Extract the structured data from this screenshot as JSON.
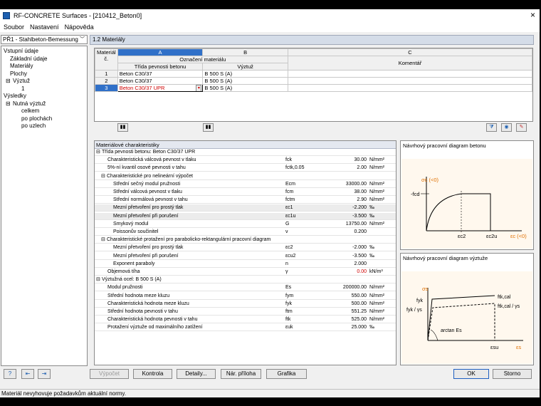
{
  "window": {
    "title": "RF-CONCRETE Surfaces - [210412_Beton0]",
    "close": "×"
  },
  "menu": [
    "Soubor",
    "Nastavení",
    "Nápověda"
  ],
  "case_combo": "PŘ1 - Stahlbeton-Bemessung",
  "tree": {
    "input": "Vstupní údaje",
    "basic": "Základní údaje",
    "materials": "Materiály",
    "surfaces": "Plochy",
    "reinf": "Výztuž",
    "reinf1": "1",
    "results": "Výsledky",
    "req": "Nutná výztuž",
    "total": "celkem",
    "surf": "po plochách",
    "nodes": "po uzlech"
  },
  "panel_title": "1.2 Materiály",
  "grid": {
    "col_material": "Materiál",
    "col_no": "č.",
    "col_a": "A",
    "col_b": "B",
    "col_c": "C",
    "hdr_designation": "Označení materiálu",
    "hdr_concrete": "Třída pevnosti betonu",
    "hdr_reinf": "Výztuž",
    "hdr_comment": "Komentář",
    "rows": [
      {
        "no": "1",
        "concrete": "Beton C30/37",
        "reinf": "B 500 S (A)"
      },
      {
        "no": "2",
        "concrete": "Beton C30/37",
        "reinf": "B 500 S (A)"
      },
      {
        "no": "3",
        "concrete": "Beton C30/37 UPR",
        "reinf": "B 500 S (A)"
      }
    ]
  },
  "props": {
    "title": "Materiálové charakteristiky",
    "sec1": "Třída pevnosti betonu: Beton C30/37 UPR",
    "r1": {
      "n": "Charakteristická válcová pevnost v tlaku",
      "s": "fck",
      "v": "30.00",
      "u": "N/mm²"
    },
    "r2": {
      "n": "5%-ní kvantil osové pevnosti v tahu",
      "s": "fctk,0.05",
      "v": "2.00",
      "u": "N/mm²"
    },
    "sec2": "Charakteristické pro nelineární výpočet",
    "r3": {
      "n": "Střední sečný modul pružnosti",
      "s": "Ecm",
      "v": "33000.00",
      "u": "N/mm²"
    },
    "r4": {
      "n": "Střední válcová pevnost v tlaku",
      "s": "fcm",
      "v": "38.00",
      "u": "N/mm²"
    },
    "r5": {
      "n": "Střední normálová pevnost v tahu",
      "s": "fctm",
      "v": "2.90",
      "u": "N/mm²"
    },
    "r6": {
      "n": "Mezní přetvoření pro prostý tlak",
      "s": "εc1",
      "v": "-2.200",
      "u": "‰"
    },
    "r7": {
      "n": "Mezní přetvoření při porušení",
      "s": "εc1u",
      "v": "-3.500",
      "u": "‰"
    },
    "r8": {
      "n": "Smykový modul",
      "s": "G",
      "v": "13750.00",
      "u": "N/mm²"
    },
    "r9": {
      "n": "Poissonův součinitel",
      "s": "ν",
      "v": "0.200",
      "u": ""
    },
    "sec3": "Charakteristické protažení pro parabolicko-rektangulární pracovní diagram",
    "r10": {
      "n": "Mezní přetvoření pro prostý tlak",
      "s": "εc2",
      "v": "-2.000",
      "u": "‰"
    },
    "r11": {
      "n": "Mezní přetvoření při porušení",
      "s": "εcu2",
      "v": "-3.500",
      "u": "‰"
    },
    "r12": {
      "n": "Exponent paraboly",
      "s": "n",
      "v": "2.000",
      "u": ""
    },
    "r13": {
      "n": "Objemová tíha",
      "s": "γ",
      "v": "0.00",
      "u": "kN/m³"
    },
    "sec4": "Výztužná ocel: B 500 S (A)",
    "r14": {
      "n": "Modul pružnosti",
      "s": "Es",
      "v": "200000.00",
      "u": "N/mm²"
    },
    "r15": {
      "n": "Střední hodnota meze kluzu",
      "s": "fym",
      "v": "550.00",
      "u": "N/mm²"
    },
    "r16": {
      "n": "Charakteristická hodnota meze kluzu",
      "s": "fyk",
      "v": "500.00",
      "u": "N/mm²"
    },
    "r17": {
      "n": "Střední hodnota pevnosti v tahu",
      "s": "ftm",
      "v": "551.25",
      "u": "N/mm²"
    },
    "r18": {
      "n": "Charakteristická hodnota pevnosti v tahu",
      "s": "ftk",
      "v": "525.00",
      "u": "N/mm²"
    },
    "r19": {
      "n": "Protažení výztuže od maximálního zatížení",
      "s": "εuk",
      "v": "25.000",
      "u": "‰"
    }
  },
  "diag1": {
    "title": "Návrhový pracovní diagram betonu",
    "yaxis": "σc (<0)",
    "fcd": "-fcd",
    "ec2": "εc2",
    "ec2u": "εc2u",
    "xaxis": "εc (<0)"
  },
  "diag2": {
    "title": "Návrhový pracovní diagram výztuže",
    "sigma": "σs",
    "fyk": "fyk",
    "fykgs": "fyk / γs",
    "ftk": "ftk,cal",
    "ftkgs": "ftk,cal / γs",
    "arctan": "arctan Es",
    "esu": "εsu",
    "es": "εs"
  },
  "buttons": {
    "calc": "Výpočet",
    "check": "Kontrola",
    "details": "Detaily...",
    "annex": "Nár. příloha",
    "graphics": "Grafika",
    "ok": "OK",
    "cancel": "Storno"
  },
  "status": "Materiál nevyhovuje požadavkům aktuální normy."
}
